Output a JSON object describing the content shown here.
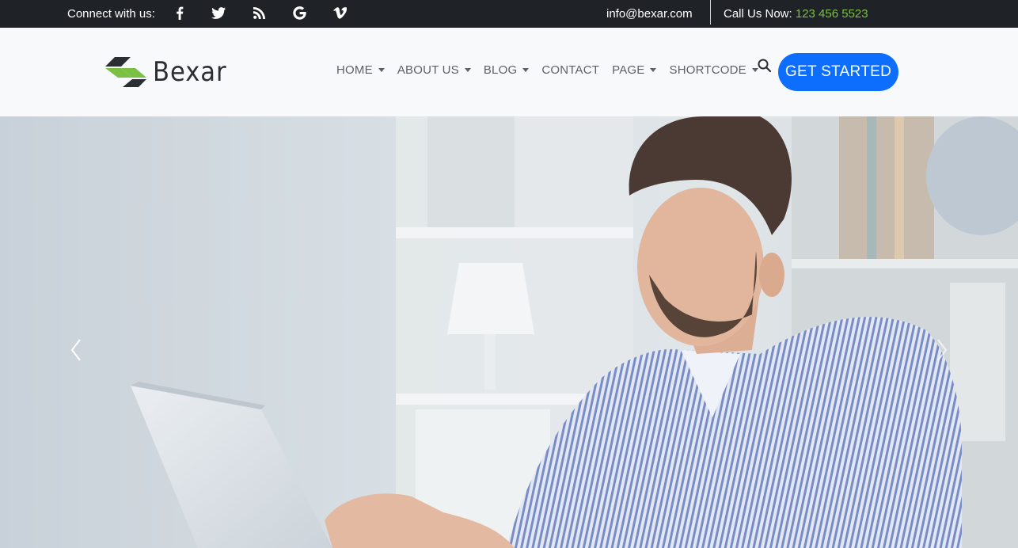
{
  "topbar": {
    "connect_label": "Connect with us:",
    "social_icons": [
      "facebook-icon",
      "twitter-icon",
      "rss-icon",
      "google-icon",
      "vimeo-icon"
    ],
    "email": "info@bexar.com",
    "call_label": "Call Us Now:",
    "phone": "123 456 5523"
  },
  "brand": {
    "name": "Bexar"
  },
  "nav": {
    "items": [
      {
        "label": "HOME",
        "dropdown": true
      },
      {
        "label": "ABOUT US",
        "dropdown": true
      },
      {
        "label": "BLOG",
        "dropdown": true
      },
      {
        "label": "CONTACT",
        "dropdown": false
      },
      {
        "label": "PAGE",
        "dropdown": true
      },
      {
        "label": "SHORTCODE",
        "dropdown": true
      }
    ],
    "cta_label": "GET STARTED"
  },
  "hero": {
    "image": "man-working-on-laptop-in-office",
    "prev_icon": "chevron-left-icon",
    "next_icon": "chevron-right-icon"
  },
  "colors": {
    "topbar_bg": "#1f2226",
    "phone": "#7bc043",
    "cta_bg": "#0d6efd",
    "logo_green": "#7bc043",
    "logo_dark": "#2b2e33"
  }
}
